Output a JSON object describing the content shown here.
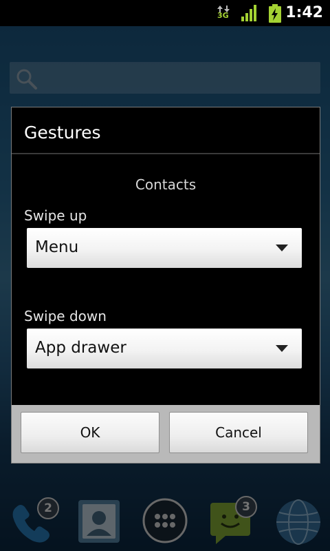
{
  "status_bar": {
    "time": "1:42",
    "network_label": "3G",
    "icons": [
      "data-arrows-icon",
      "signal-icon",
      "battery-charging-icon"
    ]
  },
  "dialog": {
    "title": "Gestures",
    "subtitle": "Contacts",
    "swipe_up": {
      "label": "Swipe up",
      "value": "Menu"
    },
    "swipe_down": {
      "label": "Swipe down",
      "value": "App drawer"
    },
    "ok_label": "OK",
    "cancel_label": "Cancel"
  },
  "dock": {
    "items": [
      {
        "icon": "phone-icon",
        "badge": "2"
      },
      {
        "icon": "contacts-icon"
      },
      {
        "icon": "app-drawer-icon"
      },
      {
        "icon": "messaging-icon",
        "badge": "3"
      },
      {
        "icon": "browser-globe-icon"
      }
    ]
  },
  "colors": {
    "dialog_bg": "#000000",
    "button_bar": "#b9b9b9",
    "battery_green": "#a4d233"
  }
}
